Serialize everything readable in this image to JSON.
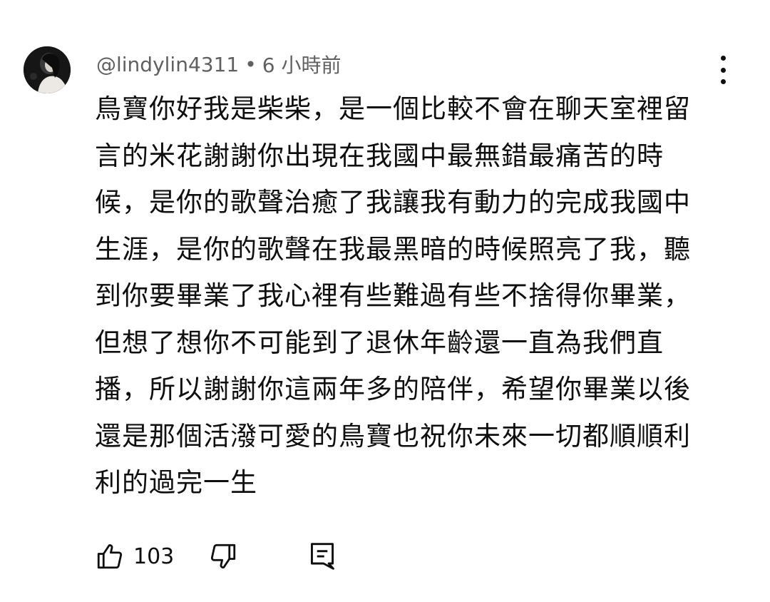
{
  "comment": {
    "author": "@lindylin4311",
    "separator": "•",
    "timestamp": "6 小時前",
    "body": "鳥寶你好我是柴柴，是一個比較不會在聊天室裡留言的米花謝謝你出現在我國中最無錯最痛苦的時候，是你的歌聲治癒了我讓我有動力的完成我國中生涯，是你的歌聲在我最黑暗的時候照亮了我，聽到你要畢業了我心裡有些難過有些不捨得你畢業，但想了想你不可能到了退休年齡還一直為我們直播，所以謝謝你這兩年多的陪伴，希望你畢業以後還是那個活潑可愛的鳥寶也祝你未來一切都順順利利的過完一生",
    "like_count": "103"
  },
  "icons": {
    "avatar": "user-avatar",
    "more": "more-vert-icon",
    "like": "thumbs-up-icon",
    "dislike": "thumbs-down-icon",
    "reply": "comment-reply-icon"
  },
  "colors": {
    "meta_text": "#606060",
    "body_text": "#0f0f0f",
    "background": "#ffffff"
  }
}
